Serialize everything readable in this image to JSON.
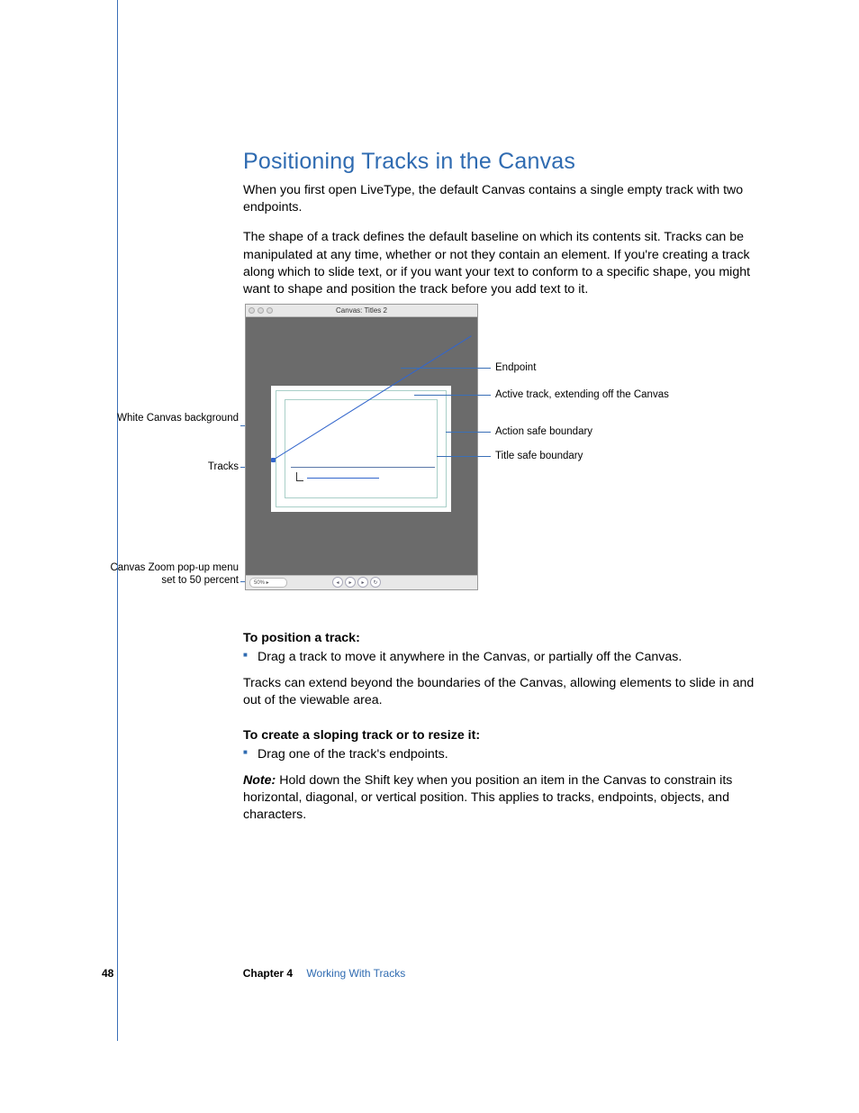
{
  "heading": "Positioning Tracks in the Canvas",
  "para1": "When you first open LiveType, the default Canvas contains a single empty track with two endpoints.",
  "para2": "The shape of a track defines the default baseline on which its contents sit. Tracks can be manipulated at any time, whether or not they contain an element. If you're creating a track along which to slide text, or if you want your text to conform to a specific shape, you might want to shape and position the track before you add text to it.",
  "figure": {
    "window_title": "Canvas: Titles 2",
    "zoom_value": "50%",
    "left_labels": {
      "white_canvas": "White Canvas background",
      "tracks": "Tracks",
      "zoom": "Canvas Zoom pop-up menu set to 50 percent"
    },
    "right_labels": {
      "endpoint": "Endpoint",
      "active_track": "Active track, extending off the Canvas",
      "action_safe": "Action safe boundary",
      "title_safe": "Title safe boundary"
    }
  },
  "sub1": "To position a track:",
  "bullet1": "Drag a track to move it anywhere in the Canvas, or partially off the Canvas.",
  "para3": "Tracks can extend beyond the boundaries of the Canvas, allowing elements to slide in and out of the viewable area.",
  "sub2": "To create a sloping track or to resize it:",
  "bullet2": "Drag one of the track's endpoints.",
  "note_label": "Note:",
  "note_body": "  Hold down the Shift key when you position an item in the Canvas to constrain its horizontal, diagonal, or vertical position. This applies to tracks, endpoints, objects, and characters.",
  "footer": {
    "page": "48",
    "chapter": "Chapter 4",
    "title": "Working With Tracks"
  }
}
